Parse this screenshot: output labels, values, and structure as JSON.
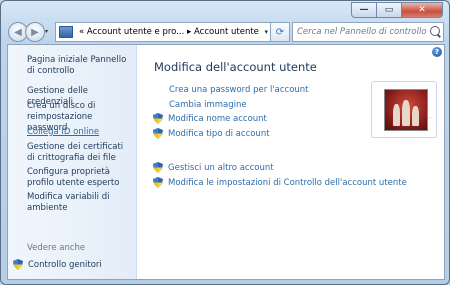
{
  "window": {
    "caption_buttons": [
      {
        "name": "minimize-button",
        "glyph": "—"
      },
      {
        "name": "maximize-button",
        "glyph": "▭"
      },
      {
        "name": "close-button",
        "glyph": "✕"
      }
    ]
  },
  "nav": {
    "back_glyph": "◀",
    "forward_glyph": "▶",
    "history_glyph": "▾",
    "address": "« Account utente e pro... ▸ Account utente",
    "address_drop_glyph": "▾",
    "refresh_glyph": "⟳",
    "search_placeholder": "Cerca nel Pannello di controllo"
  },
  "sidebar": {
    "items": [
      {
        "label": "Pagina iniziale Pannello di controllo"
      },
      {
        "label": "Gestione delle credenziali"
      },
      {
        "label": "Crea un disco di reimpostazione password"
      },
      {
        "label": "Collega ID online"
      },
      {
        "label": "Gestione dei certificati di crittografia dei file"
      },
      {
        "label": "Configura proprietà profilo utente esperto"
      },
      {
        "label": "Modifica variabili di ambiente"
      }
    ],
    "see_also": "Vedere anche",
    "parental_controls": "Controllo genitori"
  },
  "main": {
    "help_glyph": "?",
    "title": "Modifica dell'account utente",
    "tasks": [
      {
        "label": "Crea una password per l'account",
        "shield": false
      },
      {
        "label": "Cambia immagine",
        "shield": false
      },
      {
        "label": "Modifica nome account",
        "shield": true
      },
      {
        "label": "Modifica tipo di account",
        "shield": true
      },
      {
        "label": "Gestisci un altro account",
        "shield": true
      },
      {
        "label": "Modifica le impostazioni di Controllo dell'account utente",
        "shield": true
      }
    ],
    "avatar_caption": "."
  },
  "colors": {
    "link": "#2f6ca9",
    "heading": "#1e395b",
    "sidebar_bg": "#e3edf8"
  },
  "icons": {
    "uac_shield": "shield-icon",
    "avatar": "user-picture-chess"
  }
}
